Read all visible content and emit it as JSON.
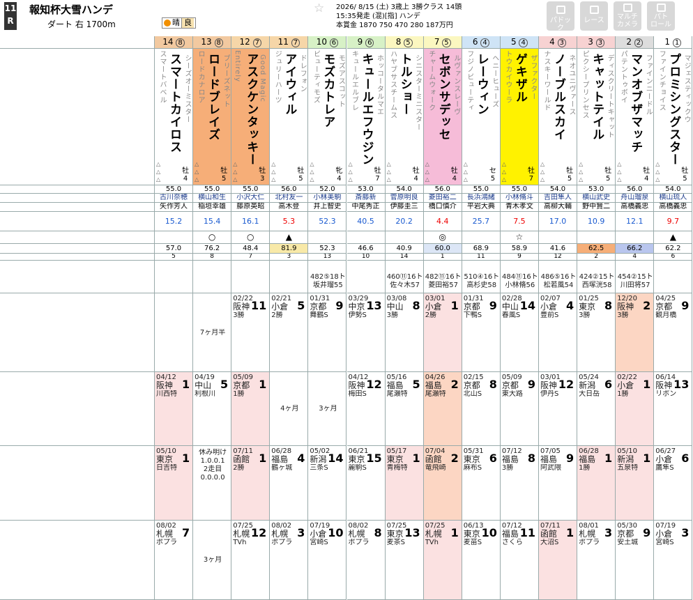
{
  "header": {
    "race_no": "11",
    "race_r": "R",
    "race_name": "報知杯大雪ハンデ",
    "course": "ダート 右 1700m",
    "weather": "晴",
    "going": "良",
    "info_line1": "2026/ 8/15 (土)  3歳上  3勝クラス  14頭",
    "info_line2": "15:35発走 (混)[指] ハンデ",
    "info_line3": "本賞金 1870 750 470 280 187万円",
    "buttons": [
      {
        "label": "パドック"
      },
      {
        "label": "レース"
      },
      {
        "label": "マルチ\nカメラ"
      },
      {
        "label": "パト\nロール"
      }
    ]
  },
  "horses": [
    {
      "frame": "8",
      "number": "14",
      "name": "スマートカイロス",
      "sire": "スマートバベル",
      "dam": "シーズオーミスター",
      "sex": "牡",
      "age": "4",
      "weight": "55.0",
      "jockey": "古川奈穂",
      "trainer": "矢作芳人",
      "odds": "15.2",
      "mark": "",
      "ext": "57.0",
      "rank": "5",
      "col": "#f2c9a0",
      "hl": ""
    },
    {
      "frame": "8",
      "number": "13",
      "name": "ロードブレイズ",
      "sire": "ロードカナロア",
      "dam": "ブリーズネット",
      "sex": "牡",
      "age": "5",
      "weight": "55.0",
      "jockey": "横山和生",
      "trainer": "稲垣幸雄",
      "odds": "15.4",
      "mark": "○",
      "ext": "76.2",
      "rank": "8",
      "col": "#f2c9a0",
      "hl": "#f6ae78"
    },
    {
      "frame": "7",
      "number": "12",
      "name": "アスクケンタッキー",
      "sire": "Entirely",
      "dam": "Good Magic",
      "sex": "牡",
      "age": "3",
      "weight": "55.0",
      "jockey": "小沢大仁",
      "trainer": "藤原英昭",
      "odds": "16.1",
      "mark": "○",
      "ext": "48.4",
      "rank": "7",
      "col": "#f6d6a8",
      "hl": "#f6ae78"
    },
    {
      "frame": "7",
      "number": "11",
      "name": "アイウィル",
      "sire": "ジュリーハーツ",
      "dam": "ドレフォン",
      "sex": "牡",
      "age": "5",
      "weight": "56.0",
      "jockey": "北村友一",
      "trainer": "高木登",
      "odds": "5.3",
      "mark": "▲",
      "ext": "81.9",
      "rank": "3",
      "col": "#f6d6a8",
      "hl": ""
    },
    {
      "frame": "6",
      "number": "10",
      "name": "モズカトレア",
      "sire": "ビューティモズ",
      "dam": "モズアスコット",
      "sex": "牝",
      "age": "4",
      "weight": "52.0",
      "jockey": "小林美駒",
      "trainer": "井上智史",
      "odds": "52.3",
      "mark": "",
      "ext": "52.3",
      "rank": "13",
      "col": "#d7f1c6",
      "hl": ""
    },
    {
      "frame": "6",
      "number": "9",
      "name": "キュールエフウジン",
      "sire": "キュールエルブレ",
      "dam": "ホッコータルマエ",
      "sex": "牡",
      "age": "7",
      "weight": "53.0",
      "jockey": "斎藤新",
      "trainer": "中尾秀正",
      "odds": "40.5",
      "mark": "",
      "ext": "46.6",
      "rank": "10",
      "col": "#d7f1c6",
      "hl": ""
    },
    {
      "frame": "5",
      "number": "8",
      "name": "トルショー",
      "sire": "ハヤブサスチームス",
      "dam": "シニスターミニスター",
      "sex": "牡",
      "age": "4",
      "weight": "54.0",
      "jockey": "菅原明良",
      "trainer": "伊藤圭三",
      "odds": "20.2",
      "mark": "",
      "ext": "40.9",
      "rank": "14",
      "col": "#fbf7c0",
      "hl": ""
    },
    {
      "frame": "5",
      "number": "7",
      "name": "セボンサデッセ",
      "sire": "チャームウォーク",
      "dam": "ルヴァンスレーヴ",
      "sex": "牡",
      "age": "4",
      "weight": "56.0",
      "jockey": "菱田裕二",
      "trainer": "橋口慎介",
      "odds": "4.4",
      "mark": "◎",
      "ext": "60.0",
      "rank": "1",
      "col": "#fbf7c0",
      "hl": "#f6bcd8"
    },
    {
      "frame": "4",
      "number": "6",
      "name": "レーウィン",
      "sire": "フジノビューティ",
      "dam": "ヘニーヒューズ",
      "sex": "セ",
      "age": "5",
      "weight": "55.0",
      "jockey": "長浜鴻緒",
      "trainer": "平岩大典",
      "odds": "25.7",
      "mark": "",
      "ext": "68.9",
      "rank": "11",
      "col": "#cfe4f6",
      "hl": ""
    },
    {
      "frame": "4",
      "number": "5",
      "name": "ゲキザル",
      "sire": "トウカイウーラ",
      "dam": "ザファクター",
      "sex": "牡",
      "age": "7",
      "weight": "55.0",
      "jockey": "小林脩斗",
      "trainer": "青木孝文",
      "odds": "7.5",
      "mark": "☆",
      "ext": "58.9",
      "rank": "9",
      "col": "#cfe4f6",
      "hl": "#fff200"
    },
    {
      "frame": "3",
      "number": "4",
      "name": "ノーブルスカイ",
      "sire": "ナスキーワールド",
      "dam": "ネオユニヴァース",
      "sex": "牡",
      "age": "5",
      "weight": "54.0",
      "jockey": "吉田隼人",
      "trainer": "高柳大輔",
      "odds": "17.0",
      "mark": "",
      "ext": "41.6",
      "rank": "12",
      "col": "#f7d2d2",
      "hl": ""
    },
    {
      "frame": "3",
      "number": "3",
      "name": "キャットテイル",
      "sire": "ピクシープリンセス",
      "dam": "ディスクリートキャット",
      "sex": "牡",
      "age": "5",
      "weight": "53.0",
      "jockey": "横山武史",
      "trainer": "野中賢二",
      "odds": "10.9",
      "mark": "",
      "ext": "62.5",
      "rank": "2",
      "col": "#f7d2d2",
      "hl": ""
    },
    {
      "frame": "2",
      "number": "2",
      "name": "マンオブザマッチ",
      "sire": "パテントゥボイ",
      "dam": "ファインニードル",
      "sex": "牡",
      "age": "4",
      "weight": "56.0",
      "jockey": "舟山瑠泉",
      "trainer": "高橋義忠",
      "odds": "12.1",
      "mark": "",
      "ext": "66.2",
      "rank": "4",
      "col": "#dddddd",
      "hl": ""
    },
    {
      "frame": "1",
      "number": "1",
      "name": "プロミシングスター",
      "sire": "ファインチョイス",
      "dam": "マジェスティックウ",
      "sex": "牡",
      "age": "5",
      "weight": "54.0",
      "jockey": "横山琉人",
      "trainer": "高橋義忠",
      "odds": "9.7",
      "mark": "▲",
      "ext": "62.2",
      "rank": "6",
      "col": "#ffffff",
      "hl": ""
    }
  ],
  "past_rows": [
    {
      "label": "",
      "cells": [
        "",
        "",
        "",
        "",
        "482⑤18ト\n坂井瑠55",
        "",
        "460⑪16ト\n佐々木57",
        "482⑪16ト\n菱田裕57",
        "510④16ト\n高杉史58",
        "484⑪16ト\n小林脩56",
        "486⑤16ト\n松若風54",
        "424②15ト\n西塚洸58",
        "454②15ト\n川田将57",
        ""
      ]
    },
    {
      "label": "3ヶ月",
      "cells": [
        "",
        "7ヶ月半",
        "02/22\n阪神11\n3勝",
        "02/21\n小倉5\n2勝",
        "01/31\n京都9\n舞鶴S",
        "03/29\n中京13\n伊勢S",
        "03/08\n中山8\n3勝",
        "03/01\n小倉1\n2勝",
        "01/31\n京都9\n下鴨S",
        "02/28\n中山14\n春風S",
        "02/07\n小倉4\n豊前S",
        "01/25\n東京8\n3勝",
        "12/20\n阪神2\n3勝",
        "04/25\n京都9\n観月橋"
      ]
    },
    {
      "label": "",
      "cells": [
        "04/12\n阪神1\n川西特",
        "04/19\n中山5\n利根川",
        "05/09\n京都1\n1勝",
        "4ヶ月",
        "3ヶ月",
        "04/12\n阪神12\n梅田S",
        "05/16\n福島5\n尾瀬特",
        "04/26\n福島2\n尾瀬特",
        "02/15\n京都8\n北山S",
        "05/09\n京都9\n東大路",
        "03/01\n阪神12\n伊丹S",
        "05/24\n新潟6\n大日岳",
        "02/22\n小倉1\n1勝",
        "06/14\n阪神13\nリボン"
      ]
    },
    {
      "label": "3ヶ月半",
      "cells": [
        "05/10\n東京1\n日吉特",
        "休み明け\n1.0.0.1\n2走目\n0.0.0.0",
        "07/11\n函館1\n2勝",
        "06/28\n福島4\n鶴ヶ城",
        "05/02\n新潟14\n三条S",
        "06/21\n東京15\n麗駒S",
        "05/17\n東京1\n青梅特",
        "07/04\n函館2\n竜飛崎",
        "05/31\n東京6\n麻布S",
        "07/12\n福島8\n3勝",
        "07/05\n福島9\n阿武隈",
        "06/28\n福島1\n1勝",
        "05/10\n新潟1\n五泉特",
        "06/27\n小倉6\n鷹隼S"
      ]
    },
    {
      "label": "",
      "cells": [
        "08/02\n札幌7\nポプラ",
        "3ヶ月",
        "07/25\n札幌12\nTVh",
        "08/02\n札幌3\nポプラ",
        "07/19\n小倉10\n宮崎S",
        "08/02\n札幌8\nポプラ",
        "07/25\n東京13\n麦茶S",
        "07/25\n札幌1\nTVh",
        "06/13\n東京10\n麦苗S",
        "07/12\n福島11\nさくら",
        "07/11\n函館1\n大沼S",
        "08/01\n札幌3\nポプラ",
        "05/30\n京都9\n安土城",
        "07/19\n小倉3\n宮崎S"
      ]
    }
  ]
}
